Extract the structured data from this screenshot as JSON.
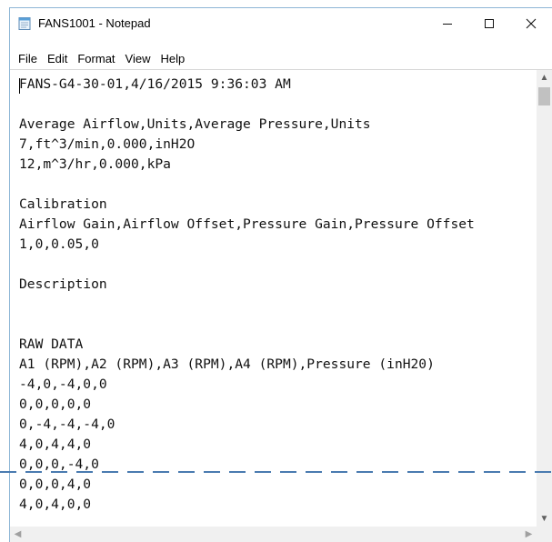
{
  "window": {
    "title": "FANS1001 - Notepad",
    "icons": {
      "app": "notepad-icon",
      "minimize": "minimize-icon",
      "maximize": "maximize-icon",
      "close": "close-icon"
    }
  },
  "menu": [
    "File",
    "Edit",
    "Format",
    "View",
    "Help"
  ],
  "document": {
    "lines": [
      "FANS-G4-30-01,4/16/2015 9:36:03 AM",
      "",
      "Average Airflow,Units,Average Pressure,Units",
      "7,ft^3/min,0.000,inH2O",
      "12,m^3/hr,0.000,kPa",
      "",
      "Calibration",
      "Airflow Gain,Airflow Offset,Pressure Gain,Pressure Offset",
      "1,0,0.05,0",
      "",
      "Description",
      "",
      "",
      "RAW DATA",
      "A1 (RPM),A2 (RPM),A3 (RPM),A4 (RPM),Pressure (inH20)",
      "-4,0,-4,0,0",
      "0,0,0,0,0",
      "0,-4,-4,-4,0",
      "4,0,4,4,0",
      "0,0,0,-4,0",
      "0,0,0,4,0",
      "4,0,4,0,0"
    ]
  },
  "scrollbars": {
    "vertical": {
      "up": "▲",
      "down": "▼"
    },
    "horizontal": {
      "left": "◀",
      "right": "▶"
    }
  },
  "colors": {
    "accent": "#4a7bb0",
    "border": "#8db6d6",
    "scrollbar": "#f0f0f0"
  }
}
